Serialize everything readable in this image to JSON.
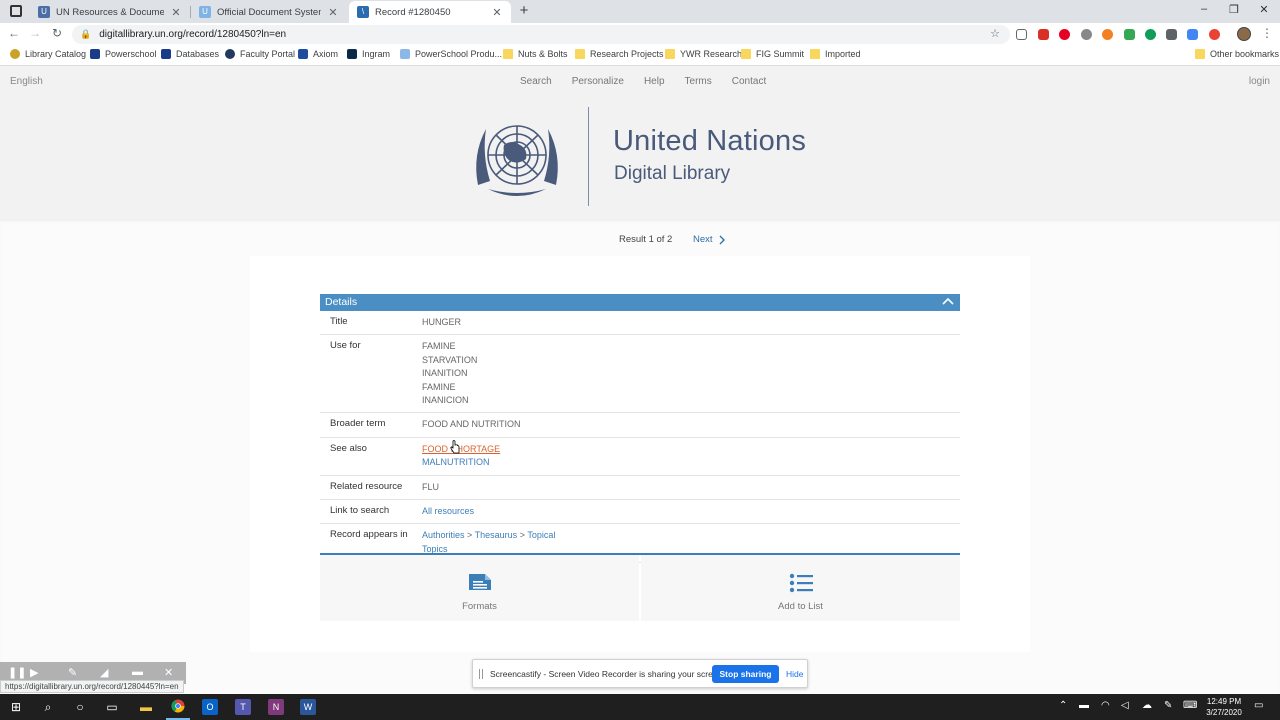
{
  "browser": {
    "tabs": [
      {
        "title": "UN Resources & Documents | Da",
        "active": false
      },
      {
        "title": "Official Document System of the",
        "active": false
      },
      {
        "title": "Record #1280450",
        "active": true
      }
    ],
    "url": "digitallibrary.un.org/record/1280450?ln=en",
    "bookmarks": [
      "Library Catalog",
      "Powerschool",
      "Databases",
      "Faculty Portal",
      "Axiom",
      "Ingram",
      "PowerSchool Produ...",
      "Nuts & Bolts",
      "Research Projects",
      "YWR Research",
      "FIG Summit",
      "Imported"
    ],
    "other_bookmarks": "Other bookmarks",
    "status_url": "https://digitallibrary.un.org/record/1280445?ln=en"
  },
  "header": {
    "language": "English",
    "nav": [
      "Search",
      "Personalize",
      "Help",
      "Terms",
      "Contact"
    ],
    "login": "login",
    "org_name": "United Nations",
    "site_name": "Digital Library"
  },
  "result_nav": {
    "position": "Result 1 of 2",
    "next": "Next"
  },
  "details": {
    "heading": "Details",
    "title_label": "Title",
    "title_value": "HUNGER",
    "use_for_label": "Use for",
    "use_for": [
      "FAMINE",
      "STARVATION",
      "INANITION",
      "FAMINE",
      "INANICION"
    ],
    "broader_label": "Broader term",
    "broader_value": "FOOD AND NUTRITION",
    "see_also_label": "See also",
    "see_also": [
      "FOOD SHORTAGE",
      "MALNUTRITION"
    ],
    "related_label": "Related resource",
    "related_value": "FLU",
    "link_label": "Link to search",
    "link_value": "All resources",
    "appears_label": "Record appears in",
    "appears": {
      "a": "Authorities",
      "sep1": ">",
      "b": "Thesaurus",
      "sep2": ">",
      "c": "Topical",
      "d": "Topics"
    }
  },
  "actions": {
    "formats": "Formats",
    "add_to_list": "Add to List"
  },
  "screencastify": {
    "message": "Screencastify - Screen Video Recorder is sharing your screen.",
    "stop": "Stop sharing",
    "hide": "Hide"
  },
  "taskbar": {
    "time": "12:49 PM",
    "date": "3/27/2020"
  },
  "colors": {
    "details_header": "#4a8ec4",
    "link": "#3c7fb8",
    "hover_link": "#d9642f",
    "un_blue": "#4a5a7a"
  }
}
